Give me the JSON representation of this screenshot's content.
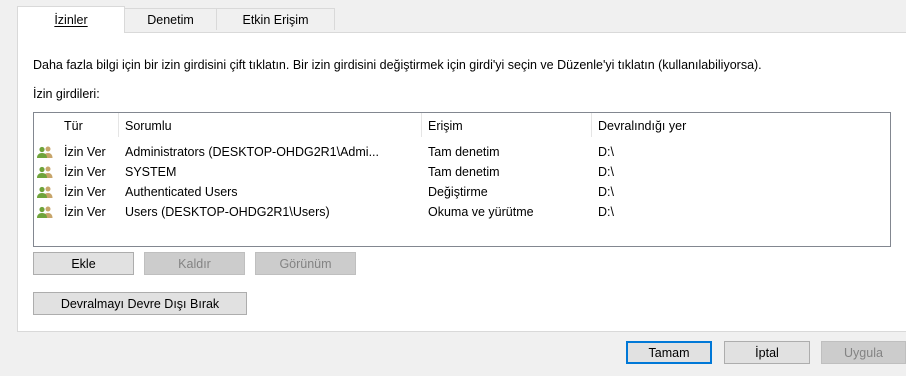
{
  "tabs": [
    {
      "label": "İzinler",
      "active": true
    },
    {
      "label": "Denetim",
      "active": false
    },
    {
      "label": "Etkin Erişim",
      "active": false
    }
  ],
  "description": "Daha fazla bilgi için bir izin girdisini çift tıklatın. Bir izin girdisini değiştirmek için girdi'yi seçin ve Düzenle'yi tıklatın (kullanılabiliyorsa).",
  "entries_label": "İzin girdileri:",
  "table": {
    "columns": [
      "Tür",
      "Sorumlu",
      "Erişim",
      "Devralındığı yer"
    ],
    "rows": [
      {
        "icon": "users-icon",
        "type": "İzin Ver",
        "principal": "Administrators (DESKTOP-OHDG2R1\\Admi...",
        "access": "Tam denetim",
        "inherited": "D:\\"
      },
      {
        "icon": "users-icon",
        "type": "İzin Ver",
        "principal": "SYSTEM",
        "access": "Tam denetim",
        "inherited": "D:\\"
      },
      {
        "icon": "users-icon",
        "type": "İzin Ver",
        "principal": "Authenticated Users",
        "access": "Değiştirme",
        "inherited": "D:\\"
      },
      {
        "icon": "users-icon",
        "type": "İzin Ver",
        "principal": "Users (DESKTOP-OHDG2R1\\Users)",
        "access": "Okuma ve yürütme",
        "inherited": "D:\\"
      }
    ]
  },
  "buttons": {
    "add": "Ekle",
    "remove": "Kaldır",
    "view": "Görünüm",
    "disable_inheritance": "Devralmayı Devre Dışı Bırak",
    "ok": "Tamam",
    "cancel": "İptal",
    "apply": "Uygula"
  },
  "colors": {
    "focus_border": "#0078d7",
    "group_icon_green": "#6fa33b",
    "group_icon_tan": "#c7a56a"
  }
}
